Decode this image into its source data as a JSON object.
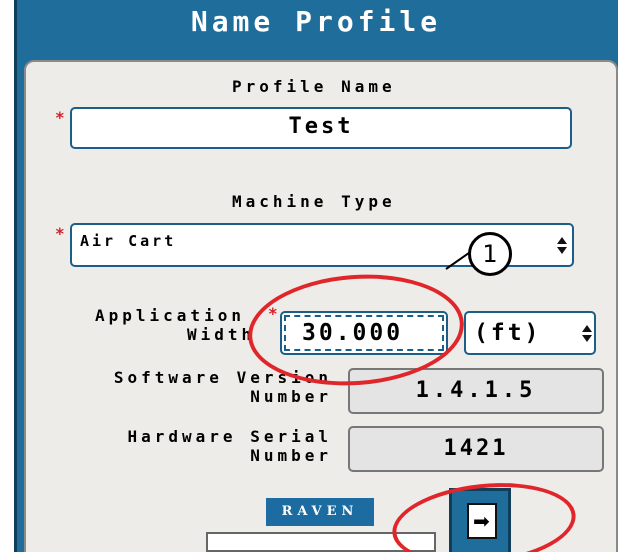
{
  "dialog": {
    "title": "Name Profile"
  },
  "profile_name": {
    "label": "Profile Name",
    "value": "Test",
    "required_mark": "*"
  },
  "machine_type": {
    "label": "Machine Type",
    "value": "Air Cart",
    "required_mark": "*"
  },
  "application_width": {
    "label_line1": "Application",
    "label_line2": "Width",
    "required_mark": "*",
    "value": "30.000",
    "unit": "(ft)"
  },
  "software_version": {
    "label_line1": "Software Version",
    "label_line2": "Number",
    "value": "1.4.1.5"
  },
  "hardware_serial": {
    "label_line1": "Hardware Serial",
    "label_line2": "Number",
    "value": "1421"
  },
  "branding": {
    "logo_text": "RAVEN"
  },
  "callout": {
    "number": "1"
  },
  "colors": {
    "frame": "#1f6d9b",
    "panel": "#eeece8",
    "callout": "#e0262a",
    "required": "#d2212b"
  },
  "icons": {
    "next": "next-page-icon"
  }
}
